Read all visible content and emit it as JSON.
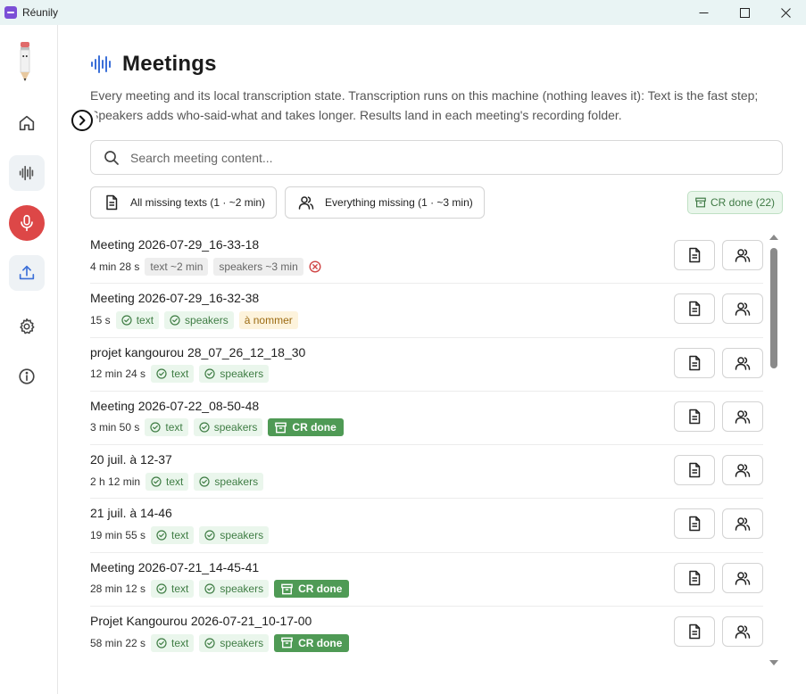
{
  "window": {
    "title": "Réunily"
  },
  "page": {
    "title": "Meetings",
    "description": "Every meeting and its local transcription state. Transcription runs on this machine (nothing leaves it): Text is the fast step; Speakers adds who-said-what and takes longer. Results land in each meeting's recording folder."
  },
  "search": {
    "placeholder": "Search meeting content..."
  },
  "actions": {
    "all_missing_texts": "All missing texts (1 · ~2 min)",
    "everything_missing": "Everything missing (1 · ~3 min)",
    "cr_done_filter": "CR done (22)"
  },
  "meetings": [
    {
      "title": "Meeting 2026-07-29_16-33-18",
      "duration": "4 min 28 s",
      "text_tag": "text ~2 min",
      "speakers_tag": "speakers ~3 min"
    },
    {
      "title": "Meeting 2026-07-29_16-32-38",
      "duration": "15 s",
      "text_tag": "text",
      "speakers_tag": "speakers",
      "extra_tag": "à nommer"
    },
    {
      "title": "projet kangourou 28_07_26_12_18_30",
      "duration": "12 min 24 s",
      "text_tag": "text",
      "speakers_tag": "speakers"
    },
    {
      "title": "Meeting 2026-07-22_08-50-48",
      "duration": "3 min 50 s",
      "text_tag": "text",
      "speakers_tag": "speakers",
      "cr_tag": "CR done"
    },
    {
      "title": "20 juil. à 12-37",
      "duration": "2 h 12 min",
      "text_tag": "text",
      "speakers_tag": "speakers"
    },
    {
      "title": "21 juil. à 14-46",
      "duration": "19 min 55 s",
      "text_tag": "text",
      "speakers_tag": "speakers"
    },
    {
      "title": "Meeting 2026-07-21_14-45-41",
      "duration": "28 min 12 s",
      "text_tag": "text",
      "speakers_tag": "speakers",
      "cr_tag": "CR done"
    },
    {
      "title": "Projet Kangourou 2026-07-21_10-17-00",
      "duration": "58 min 22 s",
      "text_tag": "text",
      "speakers_tag": "speakers",
      "cr_tag": "CR done"
    }
  ],
  "colors": {
    "accent_blue": "#3b6fd8",
    "record_red": "#dd4747",
    "success_green": "#4f9a55",
    "error_red": "#d04545"
  },
  "icons": {
    "nav": [
      "home-icon",
      "waveform-icon",
      "microphone-icon",
      "upload-icon",
      "gear-icon",
      "info-icon"
    ],
    "row_buttons": [
      "document-icon",
      "users-icon"
    ]
  }
}
